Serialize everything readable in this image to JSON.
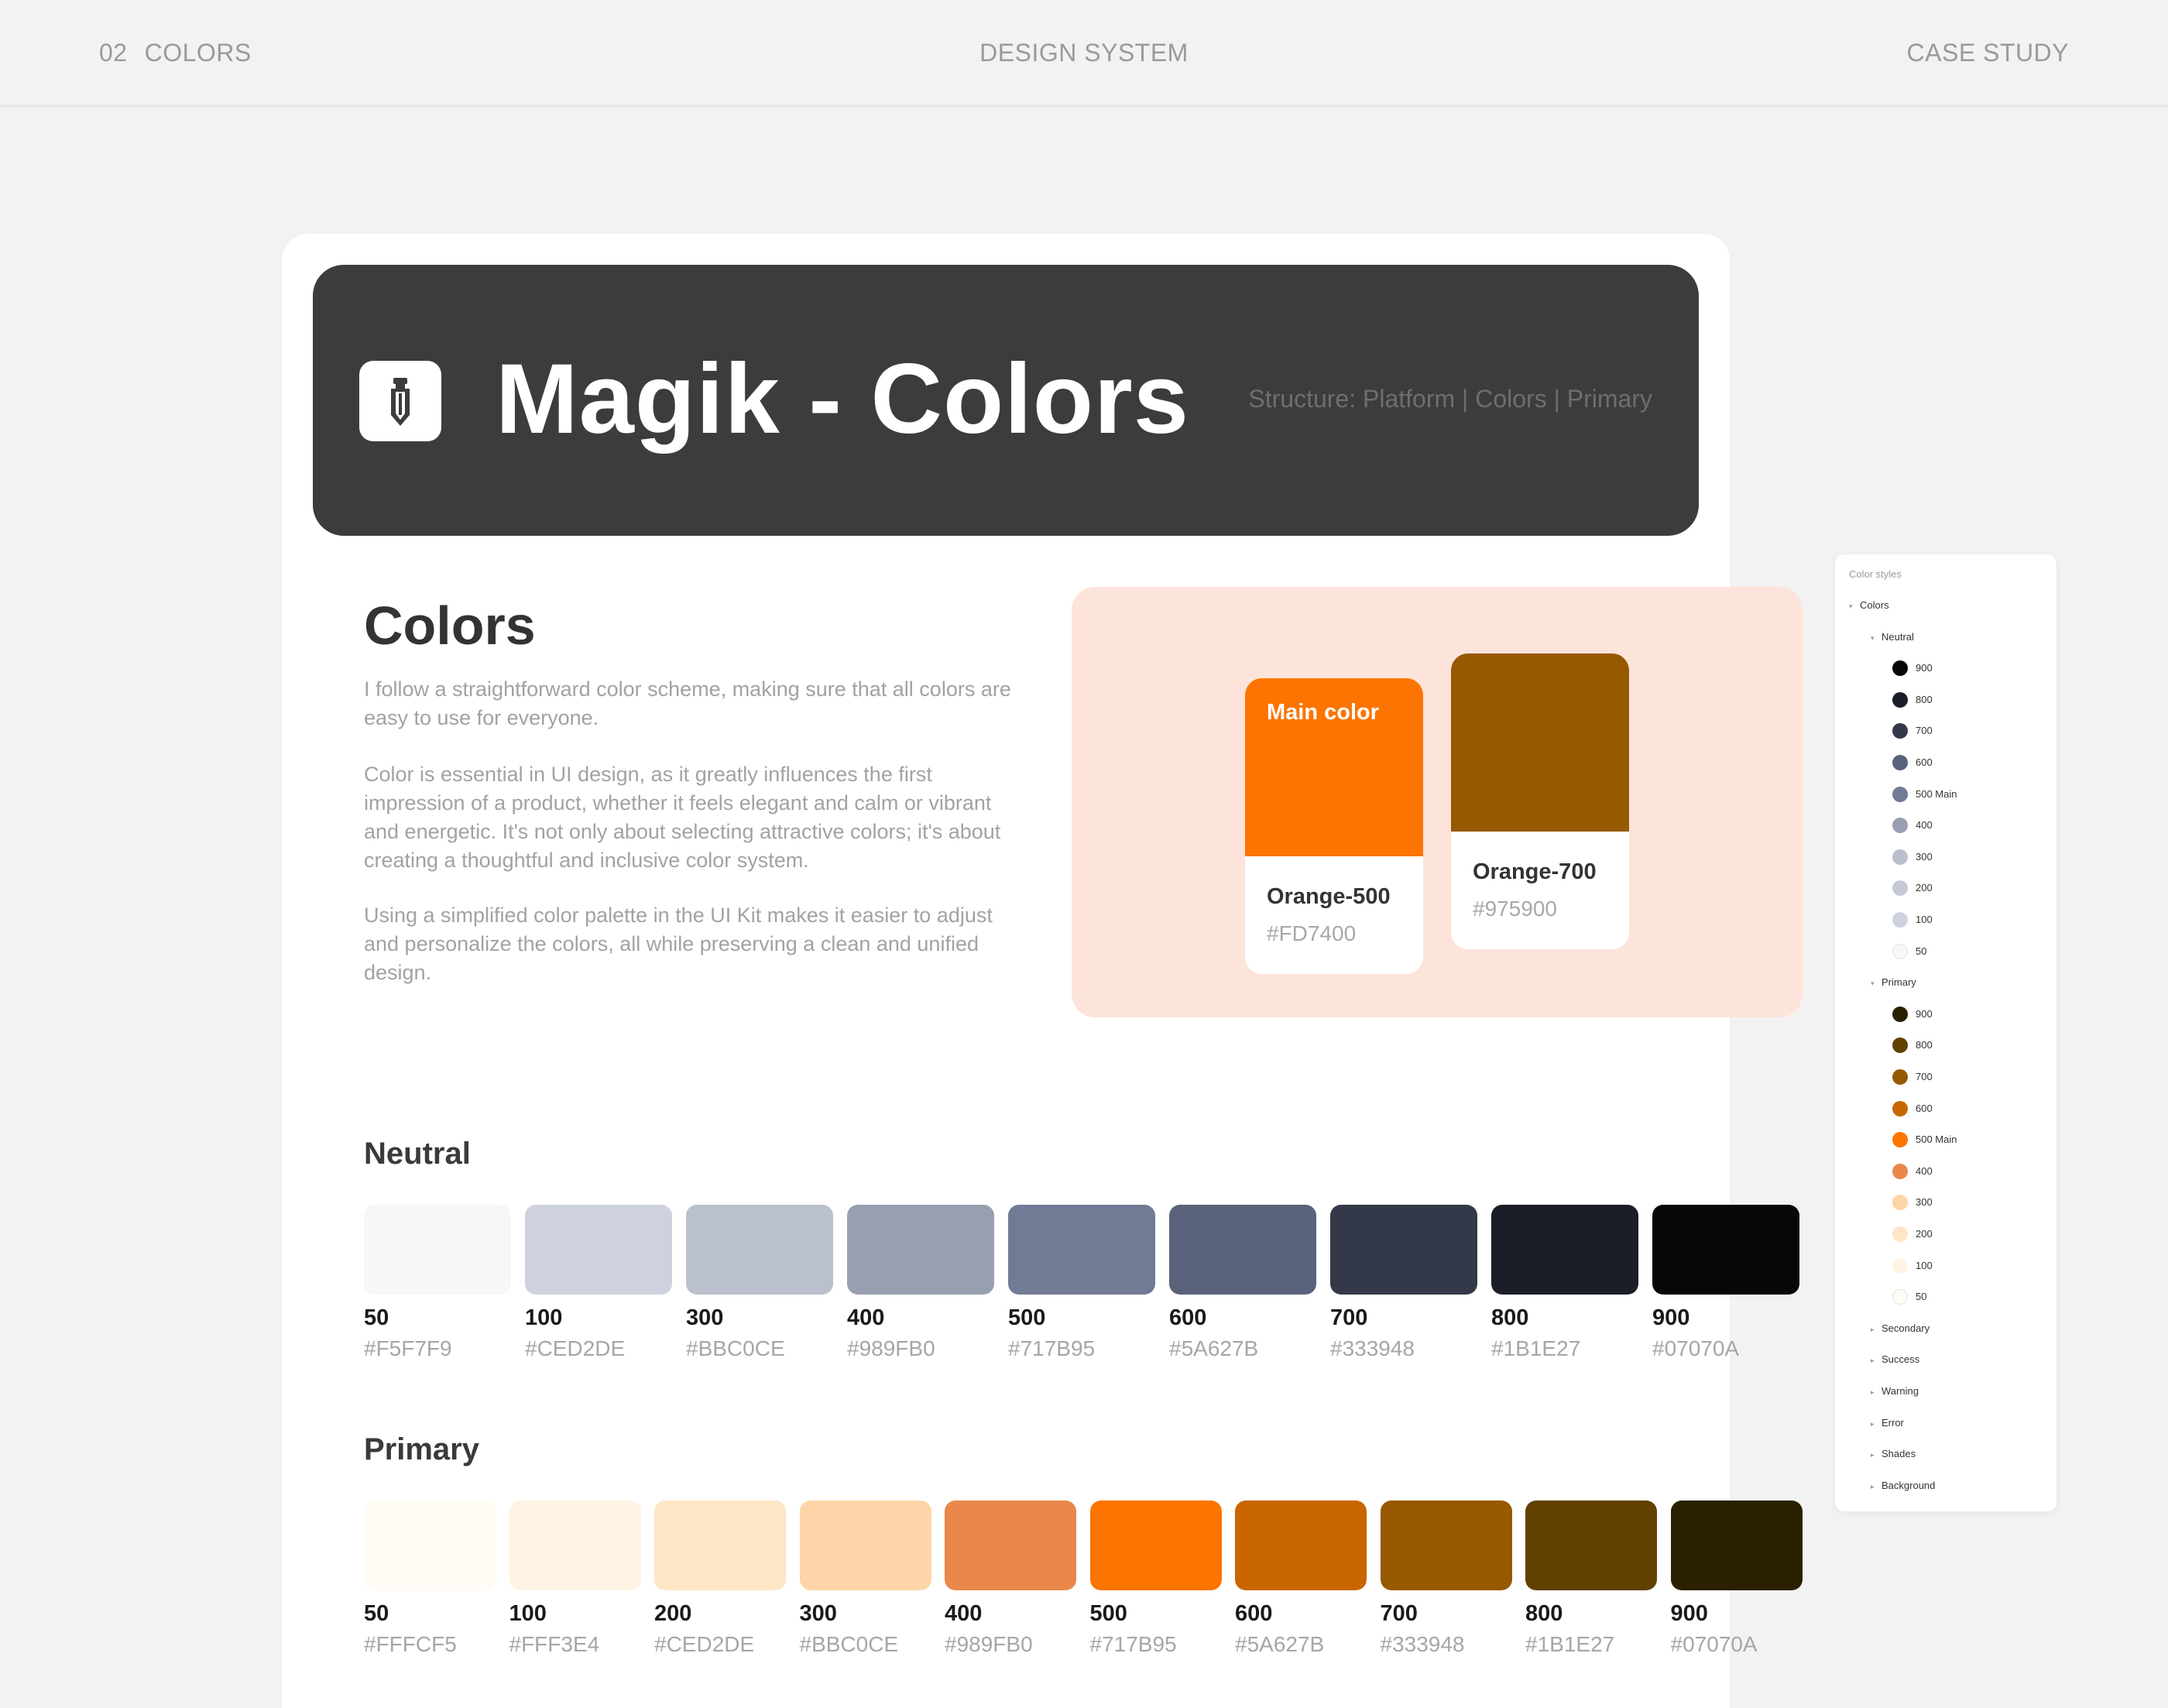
{
  "topbar": {
    "number": "02",
    "section": "COLORS",
    "center": "DESIGN SYSTEM",
    "right": "CASE STUDY"
  },
  "hero": {
    "title": "Magik - Colors",
    "structure": "Structure: Platform | Colors | Primary",
    "logo_icon": "pen-nib-icon"
  },
  "intro": {
    "heading": "Colors",
    "paragraphs": [
      "I follow a straightforward color scheme, making sure that all colors are easy to use for everyone.",
      "Color is essential in UI design, as it greatly influences the first impression of a product, whether it feels elegant and calm or vibrant and energetic. It's not only about selecting attractive colors; it's about creating a thoughtful and inclusive color system.",
      "Using a simplified color palette in the UI Kit makes it easier to adjust and personalize the colors, all while preserving a clean and unified design."
    ]
  },
  "showcase": {
    "background": "#FDE4DA",
    "cards": [
      {
        "chip_label": "Main color",
        "name": "Orange-500",
        "hex": "#FD7400",
        "color": "#FD7400"
      },
      {
        "chip_label": "",
        "name": "Orange-700",
        "hex": "#975900",
        "color": "#975900"
      }
    ]
  },
  "neutral": {
    "heading": "Neutral",
    "swatches": [
      {
        "label": "50",
        "hex": "#F5F7F9",
        "color": "#F5F7F9"
      },
      {
        "label": "100",
        "hex": "#CED2DE",
        "color": "#CED2DE"
      },
      {
        "label": "300",
        "hex": "#BBC0CE",
        "color": "#BBC0CE"
      },
      {
        "label": "400",
        "hex": "#989FB0",
        "color": "#989FB0"
      },
      {
        "label": "500",
        "hex": "#717B95",
        "color": "#717B95"
      },
      {
        "label": "600",
        "hex": "#5A627B",
        "color": "#5A627B"
      },
      {
        "label": "700",
        "hex": "#333948",
        "color": "#333948"
      },
      {
        "label": "800",
        "hex": "#1B1E27",
        "color": "#1B1E27"
      },
      {
        "label": "900",
        "hex": "#07070A",
        "color": "#07070A"
      }
    ]
  },
  "primary": {
    "heading": "Primary",
    "swatches": [
      {
        "label": "50",
        "hex": "#FFFCF5",
        "color": "#FFFCF5"
      },
      {
        "label": "100",
        "hex": "#FFF3E4",
        "color": "#FFF3E4"
      },
      {
        "label": "200",
        "hex": "#CED2DE",
        "color": "#FEE5C6"
      },
      {
        "label": "300",
        "hex": "#BBC0CE",
        "color": "#FED5A8"
      },
      {
        "label": "400",
        "hex": "#989FB0",
        "color": "#EA874A"
      },
      {
        "label": "500",
        "hex": "#717B95",
        "color": "#FD7400"
      },
      {
        "label": "600",
        "hex": "#5A627B",
        "color": "#C96600"
      },
      {
        "label": "700",
        "hex": "#333948",
        "color": "#975900"
      },
      {
        "label": "800",
        "hex": "#1B1E27",
        "color": "#624000"
      },
      {
        "label": "900",
        "hex": "#07070A",
        "color": "#2B2000"
      }
    ]
  },
  "panel": {
    "title": "Color styles",
    "root": "Colors",
    "neutral_group": "Neutral",
    "neutral_items": [
      {
        "label": "900",
        "color": "#07070A"
      },
      {
        "label": "800",
        "color": "#1B1E27"
      },
      {
        "label": "700",
        "color": "#333948"
      },
      {
        "label": "600",
        "color": "#5A627B"
      },
      {
        "label": "500 Main",
        "color": "#717B95"
      },
      {
        "label": "400",
        "color": "#989FB0"
      },
      {
        "label": "300",
        "color": "#BBC0CE"
      },
      {
        "label": "200",
        "color": "#C6CAD6"
      },
      {
        "label": "100",
        "color": "#CED2DE"
      },
      {
        "label": "50",
        "color": "#F5F7F9"
      }
    ],
    "primary_group": "Primary",
    "primary_items": [
      {
        "label": "900",
        "color": "#2B2000"
      },
      {
        "label": "800",
        "color": "#624000"
      },
      {
        "label": "700",
        "color": "#975900"
      },
      {
        "label": "600",
        "color": "#C96600"
      },
      {
        "label": "500 Main",
        "color": "#FD7400"
      },
      {
        "label": "400",
        "color": "#EA874A"
      },
      {
        "label": "300",
        "color": "#FED5A8"
      },
      {
        "label": "200",
        "color": "#FEE5C6"
      },
      {
        "label": "100",
        "color": "#FFF3E4"
      },
      {
        "label": "50",
        "color": "#FFFCF5"
      }
    ],
    "collapsed_groups": [
      "Secondary",
      "Success",
      "Warning",
      "Error",
      "Shades",
      "Background"
    ]
  }
}
